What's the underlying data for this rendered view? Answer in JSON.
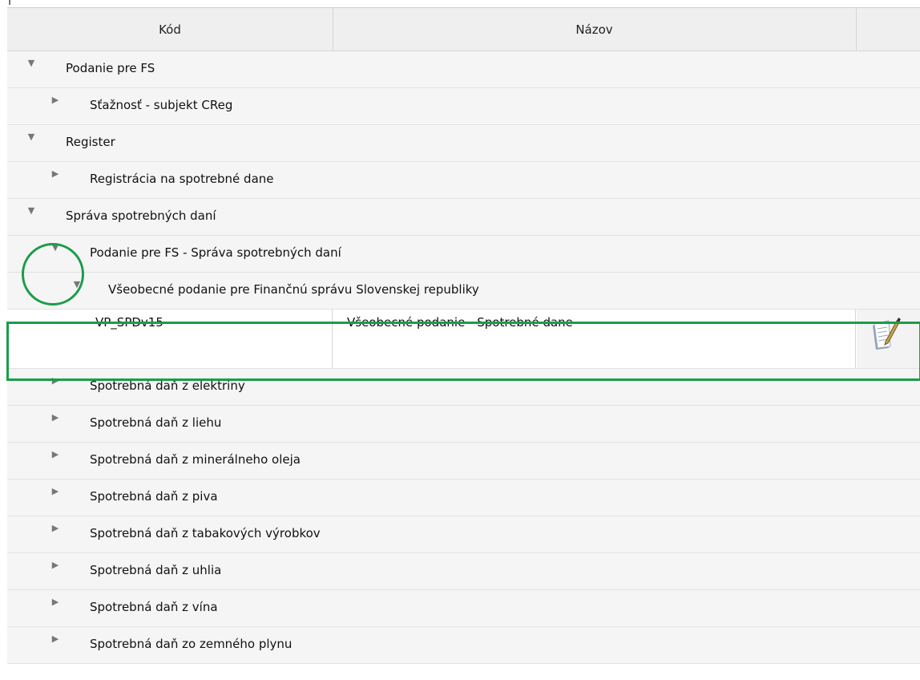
{
  "columns": {
    "code": "Kód",
    "name": "Názov",
    "action": ""
  },
  "rows": [
    {
      "label": "Podanie pre FS",
      "state": "expanded"
    },
    {
      "label": "Sťažnosť - subjekt CReg",
      "state": "collapsed"
    },
    {
      "label": "Register",
      "state": "expanded"
    },
    {
      "label": "Registrácia na spotrebné dane",
      "state": "collapsed"
    },
    {
      "label": "Správa spotrebných daní",
      "state": "expanded"
    },
    {
      "label": "Podanie pre FS - Správa spotrebných daní",
      "state": "expanded"
    },
    {
      "label": "Všeobecné podanie pre Finančnú správu Slovenskej republiky",
      "state": "expanded"
    },
    {
      "code": "VP_SPDv15",
      "name": "Všeobecné podanie - Spotrebné dane",
      "action_icon": "edit-form-icon"
    },
    {
      "label": "Spotrebná daň z elektriny",
      "state": "collapsed"
    },
    {
      "label": "Spotrebná daň z liehu",
      "state": "collapsed"
    },
    {
      "label": "Spotrebná daň z minerálneho oleja",
      "state": "collapsed"
    },
    {
      "label": "Spotrebná daň z piva",
      "state": "collapsed"
    },
    {
      "label": "Spotrebná daň z tabakových výrobkov",
      "state": "collapsed"
    },
    {
      "label": "Spotrebná daň z uhlia",
      "state": "collapsed"
    },
    {
      "label": "Spotrebná daň z vína",
      "state": "collapsed"
    },
    {
      "label": "Spotrebná daň zo zemného plynu",
      "state": "collapsed"
    }
  ],
  "highlight_color": "#1a9d49"
}
